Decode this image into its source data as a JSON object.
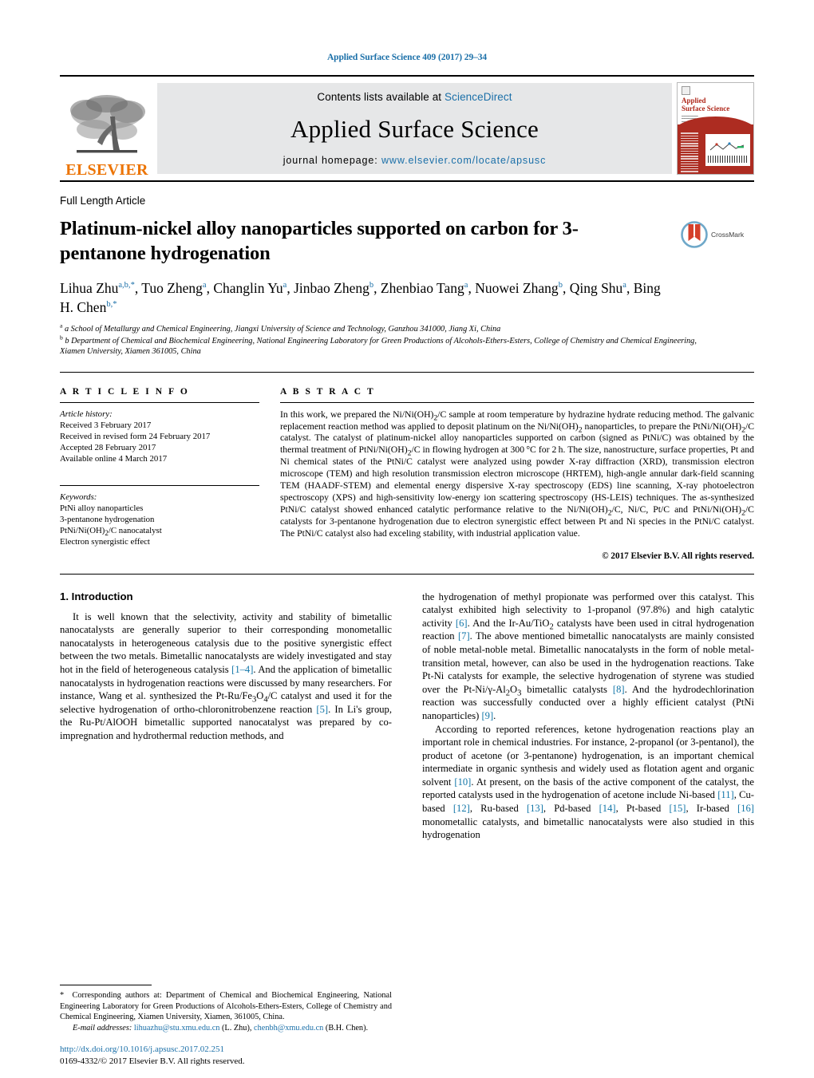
{
  "running_head": "Applied Surface Science 409 (2017) 29–34",
  "masthead": {
    "contents_prefix": "Contents lists available at ",
    "sciencedirect": "ScienceDirect",
    "journal_name": "Applied Surface Science",
    "homepage_prefix": "journal homepage: ",
    "homepage_url": "www.elsevier.com/locate/apsusc",
    "publisher_logo_text": "ELSEVIER",
    "cover": {
      "title_line1": "Applied",
      "title_line2": "Surface Science"
    },
    "accent_link_color": "#1a6fa8",
    "elsevier_orange": "#ec7404"
  },
  "article_type": "Full Length Article",
  "title": "Platinum-nickel alloy nanoparticles supported on carbon for 3-pentanone hydrogenation",
  "crossmark_label": "CrossMark",
  "authors_html": "Lihua Zhu<sup>a,b,</sup><sup>*</sup>, Tuo Zheng<sup>a</sup>, Changlin Yu<sup>a</sup>, Jinbao Zheng<sup>b</sup>, Zhenbiao Tang<sup>a</sup>, Nuowei Zhang<sup>b</sup>, Qing Shu<sup>a</sup>, Bing H. Chen<sup>b,</sup><sup>*</sup>",
  "affiliations": [
    "a School of Metallurgy and Chemical Engineering, Jiangxi University of Science and Technology, Ganzhou 341000, Jiang Xi, China",
    "b Department of Chemical and Biochemical Engineering, National Engineering Laboratory for Green Productions of Alcohols-Ethers-Esters, College of Chemistry and Chemical Engineering, Xiamen University, Xiamen 361005, China"
  ],
  "article_info": {
    "heading": "A R T I C L E   I N F O",
    "history_label": "Article history:",
    "history": [
      "Received 3 February 2017",
      "Received in revised form 24 February 2017",
      "Accepted 28 February 2017",
      "Available online 4 March 2017"
    ],
    "keywords_label": "Keywords:",
    "keywords_html": "PtNi alloy nanoparticles<br>3-pentanone hydrogenation<br>PtNi/Ni(OH)<sub>2</sub>/C nanocatalyst<br>Electron synergistic effect"
  },
  "abstract": {
    "heading": "A B S T R A C T",
    "body_html": "In this work, we prepared the Ni/Ni(OH)<sub>2</sub>/C sample at room temperature by hydrazine hydrate reducing method. The galvanic replacement reaction method was applied to deposit platinum on the Ni/Ni(OH)<sub>2</sub> nanoparticles, to prepare the PtNi/Ni(OH)<sub>2</sub>/C catalyst. The catalyst of platinum-nickel alloy nanoparticles supported on carbon (signed as PtNi/C) was obtained by the thermal treatment of PtNi/Ni(OH)<sub>2</sub>/C in flowing hydrogen at 300&#8201;&#176;C for 2&#8201;h. The size, nanostructure, surface properties, Pt and Ni chemical states of the PtNi/C catalyst were analyzed using powder X-ray diffraction (XRD), transmission electron microscope (TEM) and high resolution transmission electron microscope (HRTEM), high-angle annular dark-field scanning TEM (HAADF-STEM) and elemental energy dispersive X-ray spectroscopy (EDS) line scanning, X-ray photoelectron spectroscopy (XPS) and high-sensitivity low-energy ion scattering spectroscopy (HS-LEIS) techniques. The as-synthesized PtNi/C catalyst showed enhanced catalytic performance relative to the Ni/Ni(OH)<sub>2</sub>/C, Ni/C, Pt/C and PtNi/Ni(OH)<sub>2</sub>/C catalysts for 3-pentanone hydrogenation due to electron synergistic effect between Pt and Ni species in the PtNi/C catalyst. The PtNi/C catalyst also had exceling stability, with industrial application value.",
    "copyright": "© 2017 Elsevier B.V. All rights reserved."
  },
  "sections": {
    "introduction_heading": "1.  Introduction",
    "left_paragraphs_html": [
      "It is well known that the selectivity, activity and stability of bimetallic nanocatalysts are generally superior to their corresponding monometallic nanocatalysts in heterogeneous catalysis due to the positive synergistic effect between the two metals. Bimetallic nanocatalysts are widely investigated and stay hot in the field of heterogeneous catalysis <span class=\"ref\">[1&#8211;4]</span>. And the application of bimetallic nanocatalysts in hydrogenation reactions were discussed by many researchers. For instance, Wang et al. synthesized the Pt-Ru/Fe<sub>3</sub>O<sub>4</sub>/C catalyst and used it for the selective hydrogenation of ortho-chloronitrobenzene reaction <span class=\"ref\">[5]</span>. In Li's group, the Ru-Pt/AlOOH bimetallic supported nanocatalyst was prepared by co-impregnation and hydrothermal reduction methods, and"
    ],
    "right_paragraphs_html": [
      "the hydrogenation of methyl propionate was performed over this catalyst. This catalyst exhibited high selectivity to 1-propanol (97.8%) and high catalytic activity <span class=\"ref\">[6]</span>. And the Ir-Au/TiO<sub>2</sub> catalysts have been used in citral hydrogenation reaction <span class=\"ref\">[7]</span>. The above mentioned bimetallic nanocatalysts are mainly consisted of noble metal-noble metal. Bimetallic nanocatalysts in the form of noble metal-transition metal, however, can also be used in the hydrogenation reactions. Take Pt-Ni catalysts for example, the selective hydrogenation of styrene was studied over the Pt-Ni/&#947;-Al<sub>2</sub>O<sub>3</sub> bimetallic catalysts <span class=\"ref\">[8]</span>. And the hydrodechlorination reaction was successfully conducted over a highly efficient catalyst (PtNi nanoparticles) <span class=\"ref\">[9]</span>.",
      "According to reported references, ketone hydrogenation reactions play an important role in chemical industries. For instance, 2-propanol (or 3-pentanol), the product of acetone (or 3-pentanone) hydrogenation, is an important chemical intermediate in organic synthesis and widely used as flotation agent and organic solvent <span class=\"ref\">[10]</span>. At present, on the basis of the active component of the catalyst, the reported catalysts used in the hydrogenation of acetone include Ni-based <span class=\"ref\">[11]</span>, Cu-based <span class=\"ref\">[12]</span>, Ru-based <span class=\"ref\">[13]</span>, Pd-based <span class=\"ref\">[14]</span>, Pt-based <span class=\"ref\">[15]</span>, Ir-based <span class=\"ref\">[16]</span> monometallic catalysts, and bimetallic nanocatalysts were also studied in this hydrogenation"
    ]
  },
  "footnotes": {
    "corresponding_html": "<span class=\"star\">*</span>&nbsp; Corresponding authors at: Department of Chemical and Biochemical Engineering, National Engineering Laboratory for Green Productions of Alcohols-Ethers-Esters, College of Chemistry and Chemical Engineering, Xiamen University, Xiamen, 361005, China.",
    "email_label": "E-mail addresses:",
    "email_1": "lihuazhu@stu.xmu.edu.cn",
    "email_1_owner": "(L. Zhu),",
    "email_2": "chenbh@xmu.edu.cn",
    "email_2_owner": "(B.H. Chen)."
  },
  "doi": "http://dx.doi.org/10.1016/j.apsusc.2017.02.251",
  "issn_line": "0169-4332/© 2017 Elsevier B.V. All rights reserved."
}
